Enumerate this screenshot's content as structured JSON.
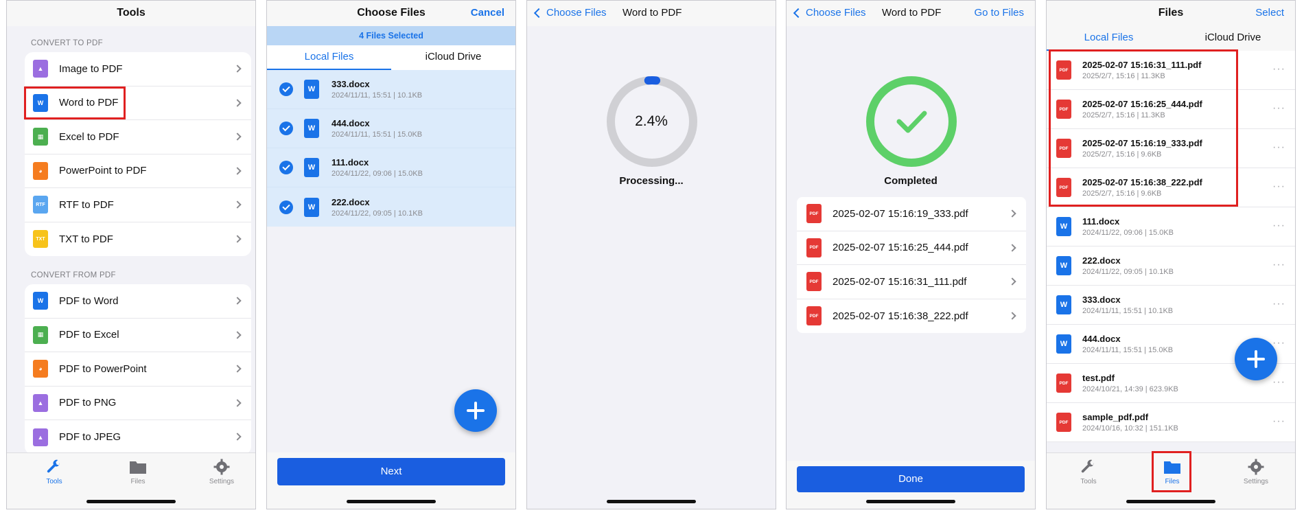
{
  "colors": {
    "accent": "#1a73e8",
    "highlight": "#e02020",
    "success": "#5dd068",
    "pdf_red": "#e53935"
  },
  "panel1": {
    "title": "Tools",
    "section_to": "CONVERT TO PDF",
    "to_items": [
      {
        "label": "Image to PDF",
        "icon": "image-icon",
        "color": "#9b6ee0",
        "glyph": "▲"
      },
      {
        "label": "Word to PDF",
        "icon": "word-icon",
        "color": "#1a73e8",
        "glyph": "W"
      },
      {
        "label": "Excel to PDF",
        "icon": "excel-icon",
        "color": "#4caf50",
        "glyph": "▦"
      },
      {
        "label": "PowerPoint to PDF",
        "icon": "powerpoint-icon",
        "color": "#f57c1f",
        "glyph": "◕"
      },
      {
        "label": "RTF to PDF",
        "icon": "rtf-icon",
        "color": "#5aa6f0",
        "glyph": "RTF"
      },
      {
        "label": "TXT to PDF",
        "icon": "txt-icon",
        "color": "#f7c31b",
        "glyph": "TXT"
      }
    ],
    "section_from": "CONVERT FROM PDF",
    "from_items": [
      {
        "label": "PDF to Word",
        "icon": "word-icon",
        "color": "#1a73e8",
        "glyph": "W"
      },
      {
        "label": "PDF to Excel",
        "icon": "excel-icon",
        "color": "#4caf50",
        "glyph": "▦"
      },
      {
        "label": "PDF to PowerPoint",
        "icon": "powerpoint-icon",
        "color": "#f57c1f",
        "glyph": "◕"
      },
      {
        "label": "PDF to PNG",
        "icon": "image-icon",
        "color": "#9b6ee0",
        "glyph": "▲"
      },
      {
        "label": "PDF to JPEG",
        "icon": "image-icon",
        "color": "#9b6ee0",
        "glyph": "▲"
      }
    ],
    "tabs": [
      "Tools",
      "Files",
      "Settings"
    ]
  },
  "panel2": {
    "title": "Choose Files",
    "cancel": "Cancel",
    "selected_banner": "4 Files Selected",
    "tab_local": "Local Files",
    "tab_icloud": "iCloud Drive",
    "files": [
      {
        "name": "333.docx",
        "meta": "2024/11/11, 15:51 | 10.1KB"
      },
      {
        "name": "444.docx",
        "meta": "2024/11/11, 15:51 | 15.0KB"
      },
      {
        "name": "111.docx",
        "meta": "2024/11/22, 09:06 | 15.0KB"
      },
      {
        "name": "222.docx",
        "meta": "2024/11/22, 09:05 | 10.1KB"
      }
    ],
    "next": "Next"
  },
  "panel3": {
    "back": "Choose Files",
    "title": "Word to PDF",
    "percent": "2.4%",
    "progress": 0.024,
    "status": "Processing..."
  },
  "panel4": {
    "back": "Choose Files",
    "title": "Word to PDF",
    "go_to_files": "Go to Files",
    "status": "Completed",
    "results": [
      "2025-02-07 15:16:19_333.pdf",
      "2025-02-07 15:16:25_444.pdf",
      "2025-02-07 15:16:31_111.pdf",
      "2025-02-07 15:16:38_222.pdf"
    ],
    "done": "Done"
  },
  "panel5": {
    "title": "Files",
    "select": "Select",
    "tab_local": "Local Files",
    "tab_icloud": "iCloud Drive",
    "files": [
      {
        "name": "2025-02-07 15:16:31_111.pdf",
        "meta": "2025/2/7, 15:16 | 11.3KB",
        "type": "pdf"
      },
      {
        "name": "2025-02-07 15:16:25_444.pdf",
        "meta": "2025/2/7, 15:16 | 11.3KB",
        "type": "pdf"
      },
      {
        "name": "2025-02-07 15:16:19_333.pdf",
        "meta": "2025/2/7, 15:16 | 9.6KB",
        "type": "pdf"
      },
      {
        "name": "2025-02-07 15:16:38_222.pdf",
        "meta": "2025/2/7, 15:16 | 9.6KB",
        "type": "pdf"
      },
      {
        "name": "111.docx",
        "meta": "2024/11/22, 09:06 | 15.0KB",
        "type": "doc"
      },
      {
        "name": "222.docx",
        "meta": "2024/11/22, 09:05 | 10.1KB",
        "type": "doc"
      },
      {
        "name": "333.docx",
        "meta": "2024/11/11, 15:51 | 10.1KB",
        "type": "doc"
      },
      {
        "name": "444.docx",
        "meta": "2024/11/11, 15:51 | 15.0KB",
        "type": "doc"
      },
      {
        "name": "test.pdf",
        "meta": "2024/10/21, 14:39 | 623.9KB",
        "type": "pdf"
      },
      {
        "name": "sample_pdf.pdf",
        "meta": "2024/10/16, 10:32 | 151.1KB",
        "type": "pdf"
      }
    ],
    "more_glyph": "···",
    "tabs": [
      "Tools",
      "Files",
      "Settings"
    ]
  },
  "icon_labels": {
    "word": "W",
    "pdf": "PDF"
  }
}
